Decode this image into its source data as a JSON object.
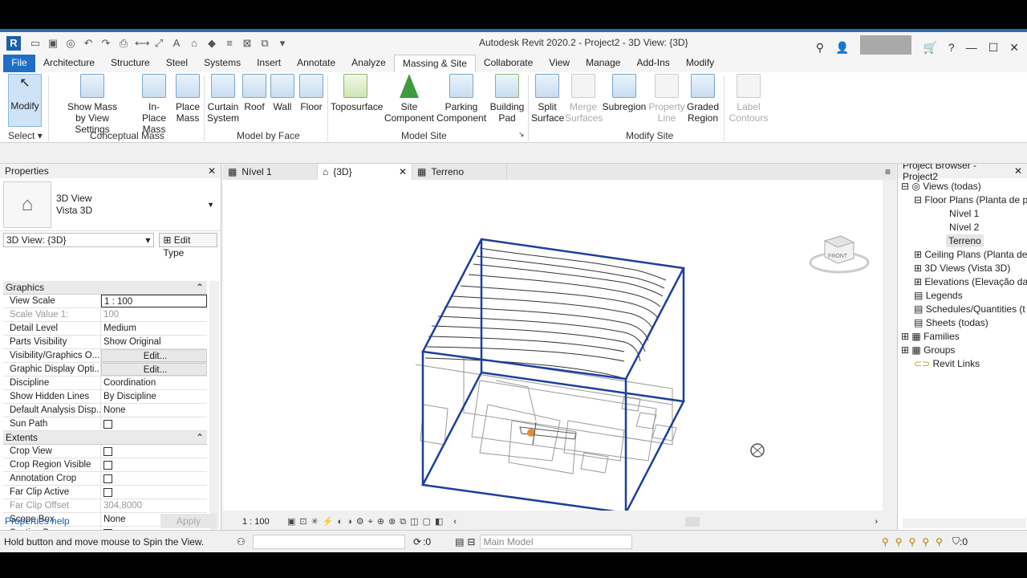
{
  "window": {
    "title": "Autodesk Revit 2020.2 - Project2 - 3D View: {3D}"
  },
  "ribbon_tabs": [
    "File",
    "Architecture",
    "Structure",
    "Steel",
    "Systems",
    "Insert",
    "Annotate",
    "Analyze",
    "Massing & Site",
    "Collaborate",
    "View",
    "Manage",
    "Add-Ins",
    "Modify"
  ],
  "ribbon": {
    "modify": "Modify",
    "select": "Select",
    "show_mass": [
      "Show Mass",
      "by View Settings"
    ],
    "inplace_mass": [
      "In-Place",
      "Mass"
    ],
    "place_mass": [
      "Place",
      "Mass"
    ],
    "curtain_system": [
      "Curtain",
      "System"
    ],
    "roof": "Roof",
    "wall": "Wall",
    "floor": "Floor",
    "toposurface": "Toposurface",
    "site_component": [
      "Site",
      "Component"
    ],
    "parking_component": [
      "Parking",
      "Component"
    ],
    "building_pad": [
      "Building",
      "Pad"
    ],
    "split_surface": [
      "Split",
      "Surface"
    ],
    "merge_surfaces": [
      "Merge",
      "Surfaces"
    ],
    "subregion": "Subregion",
    "property_line": [
      "Property",
      "Line"
    ],
    "graded_region": [
      "Graded",
      "Region"
    ],
    "label_contours": [
      "Label",
      "Contours"
    ],
    "panels": {
      "conceptual_mass": "Conceptual Mass",
      "model_by_face": "Model by Face",
      "model_site": "Model Site",
      "modify_site": "Modify Site"
    }
  },
  "properties": {
    "title": "Properties",
    "type_line1": "3D View",
    "type_line2": "Vista 3D",
    "selector": "3D View: {3D}",
    "edit_type": "Edit Type",
    "groups": {
      "graphics": "Graphics",
      "extents": "Extents"
    },
    "rows": {
      "view_scale": [
        "View Scale",
        "1 : 100"
      ],
      "scale_value": [
        "Scale Value    1:",
        "100"
      ],
      "detail_level": [
        "Detail Level",
        "Medium"
      ],
      "parts_visibility": [
        "Parts Visibility",
        "Show Original"
      ],
      "vis_graphics": [
        "Visibility/Graphics O...",
        "Edit..."
      ],
      "graphic_display": [
        "Graphic Display Opti...",
        "Edit..."
      ],
      "discipline": [
        "Discipline",
        "Coordination"
      ],
      "hidden_lines": [
        "Show Hidden Lines",
        "By Discipline"
      ],
      "analysis_display": [
        "Default Analysis Disp...",
        "None"
      ],
      "sun_path": [
        "Sun Path",
        ""
      ],
      "crop_view": [
        "Crop View",
        ""
      ],
      "crop_region_visible": [
        "Crop Region Visible",
        ""
      ],
      "annotation_crop": [
        "Annotation Crop",
        ""
      ],
      "far_clip_active": [
        "Far Clip Active",
        ""
      ],
      "far_clip_offset": [
        "Far Clip Offset",
        "304,8000"
      ],
      "scope_box": [
        "Scope Box",
        "None"
      ],
      "section_box": [
        "Section Box",
        ""
      ]
    },
    "help": "Properties help",
    "apply": "Apply"
  },
  "view_tabs": [
    "Nível 1",
    "{3D}",
    "Terreno"
  ],
  "view_scale": "1 : 100",
  "browser": {
    "title": "Project Browser - Project2",
    "items": {
      "views": "Views (todas)",
      "floor_plans": "Floor Plans (Planta de p",
      "nivel1": "Nível 1",
      "nivel2": "Nível 2",
      "terreno": "Terreno",
      "ceiling_plans": "Ceiling Plans (Planta de",
      "views3d": "3D Views (Vista 3D)",
      "elevations": "Elevations (Elevação da",
      "legends": "Legends",
      "schedules": "Schedules/Quantities (t",
      "sheets": "Sheets (todas)",
      "families": "Families",
      "groups": "Groups",
      "revit_links": "Revit Links"
    }
  },
  "status": {
    "message": "Hold button and move mouse to Spin the View.",
    "workset_count": ":0",
    "model": "Main Model",
    "filter_count": ":0"
  },
  "viewcube_face": "FRONT"
}
